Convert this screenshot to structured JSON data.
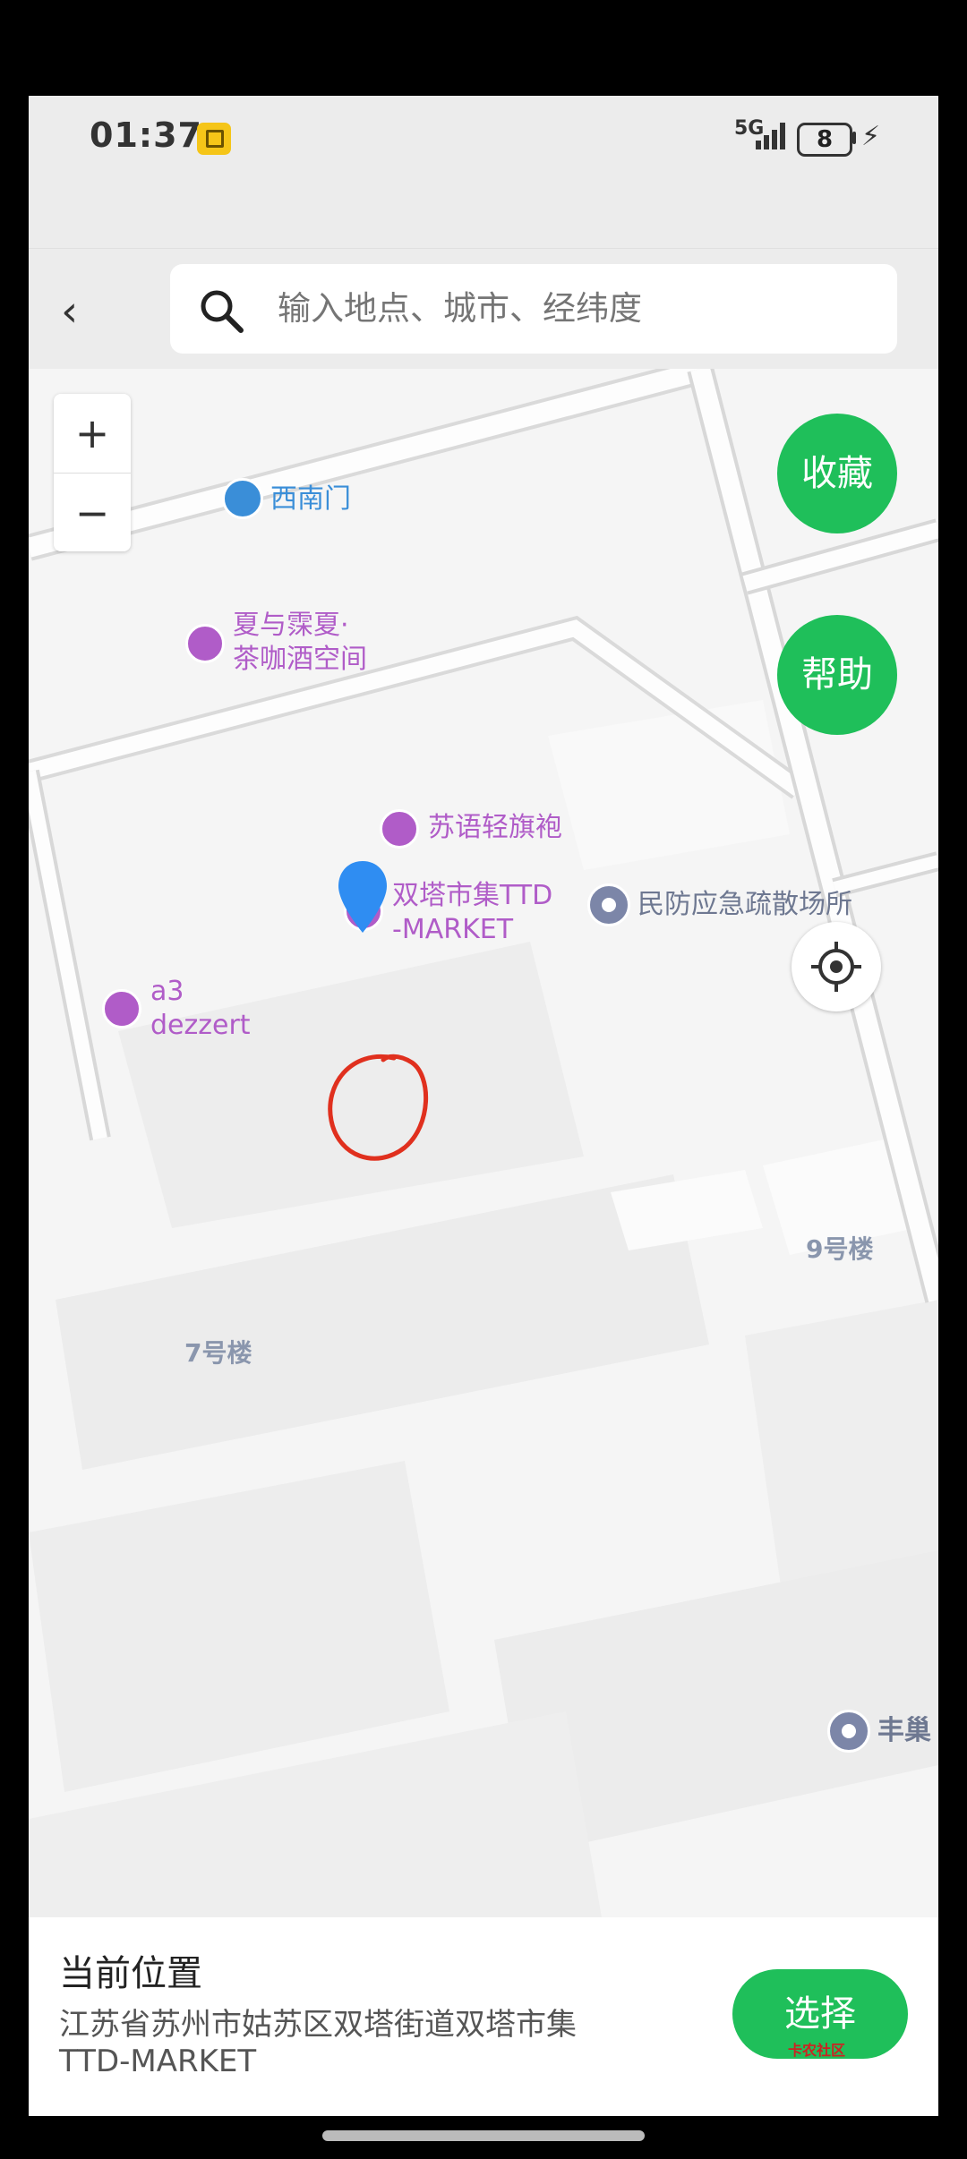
{
  "status_bar": {
    "time": "01:37",
    "network": "5G",
    "battery": "8"
  },
  "search": {
    "placeholder": "输入地点、城市、经纬度"
  },
  "map": {
    "zoom_in": "+",
    "zoom_out": "−",
    "favorite_button": "收藏",
    "help_button": "帮助",
    "pois": {
      "gate": "西南门",
      "cafe_line1": "夏与霂夏·",
      "cafe_line2": "茶咖酒空间",
      "suyu": "苏语轻旗袍",
      "market_line1": "双塔市集TTD",
      "market_line2": "-MARKET",
      "civil_defense": "民防应急疏散场所",
      "a3_line1": "a3",
      "a3_line2": "dezzert",
      "fengchao": "丰巢"
    },
    "buildings": {
      "b9": "9号楼",
      "b7": "7号楼"
    }
  },
  "panel": {
    "title": "当前位置",
    "address": "江苏省苏州市姑苏区双塔街道双塔市集TTD-MARKET",
    "select_button": "选择",
    "watermark": "卡农社区"
  },
  "colors": {
    "accent_green": "#1fbf5a",
    "poi_purple": "#b05cc8",
    "pin_blue": "#2f8df2",
    "annotation_red": "#e0301e"
  }
}
